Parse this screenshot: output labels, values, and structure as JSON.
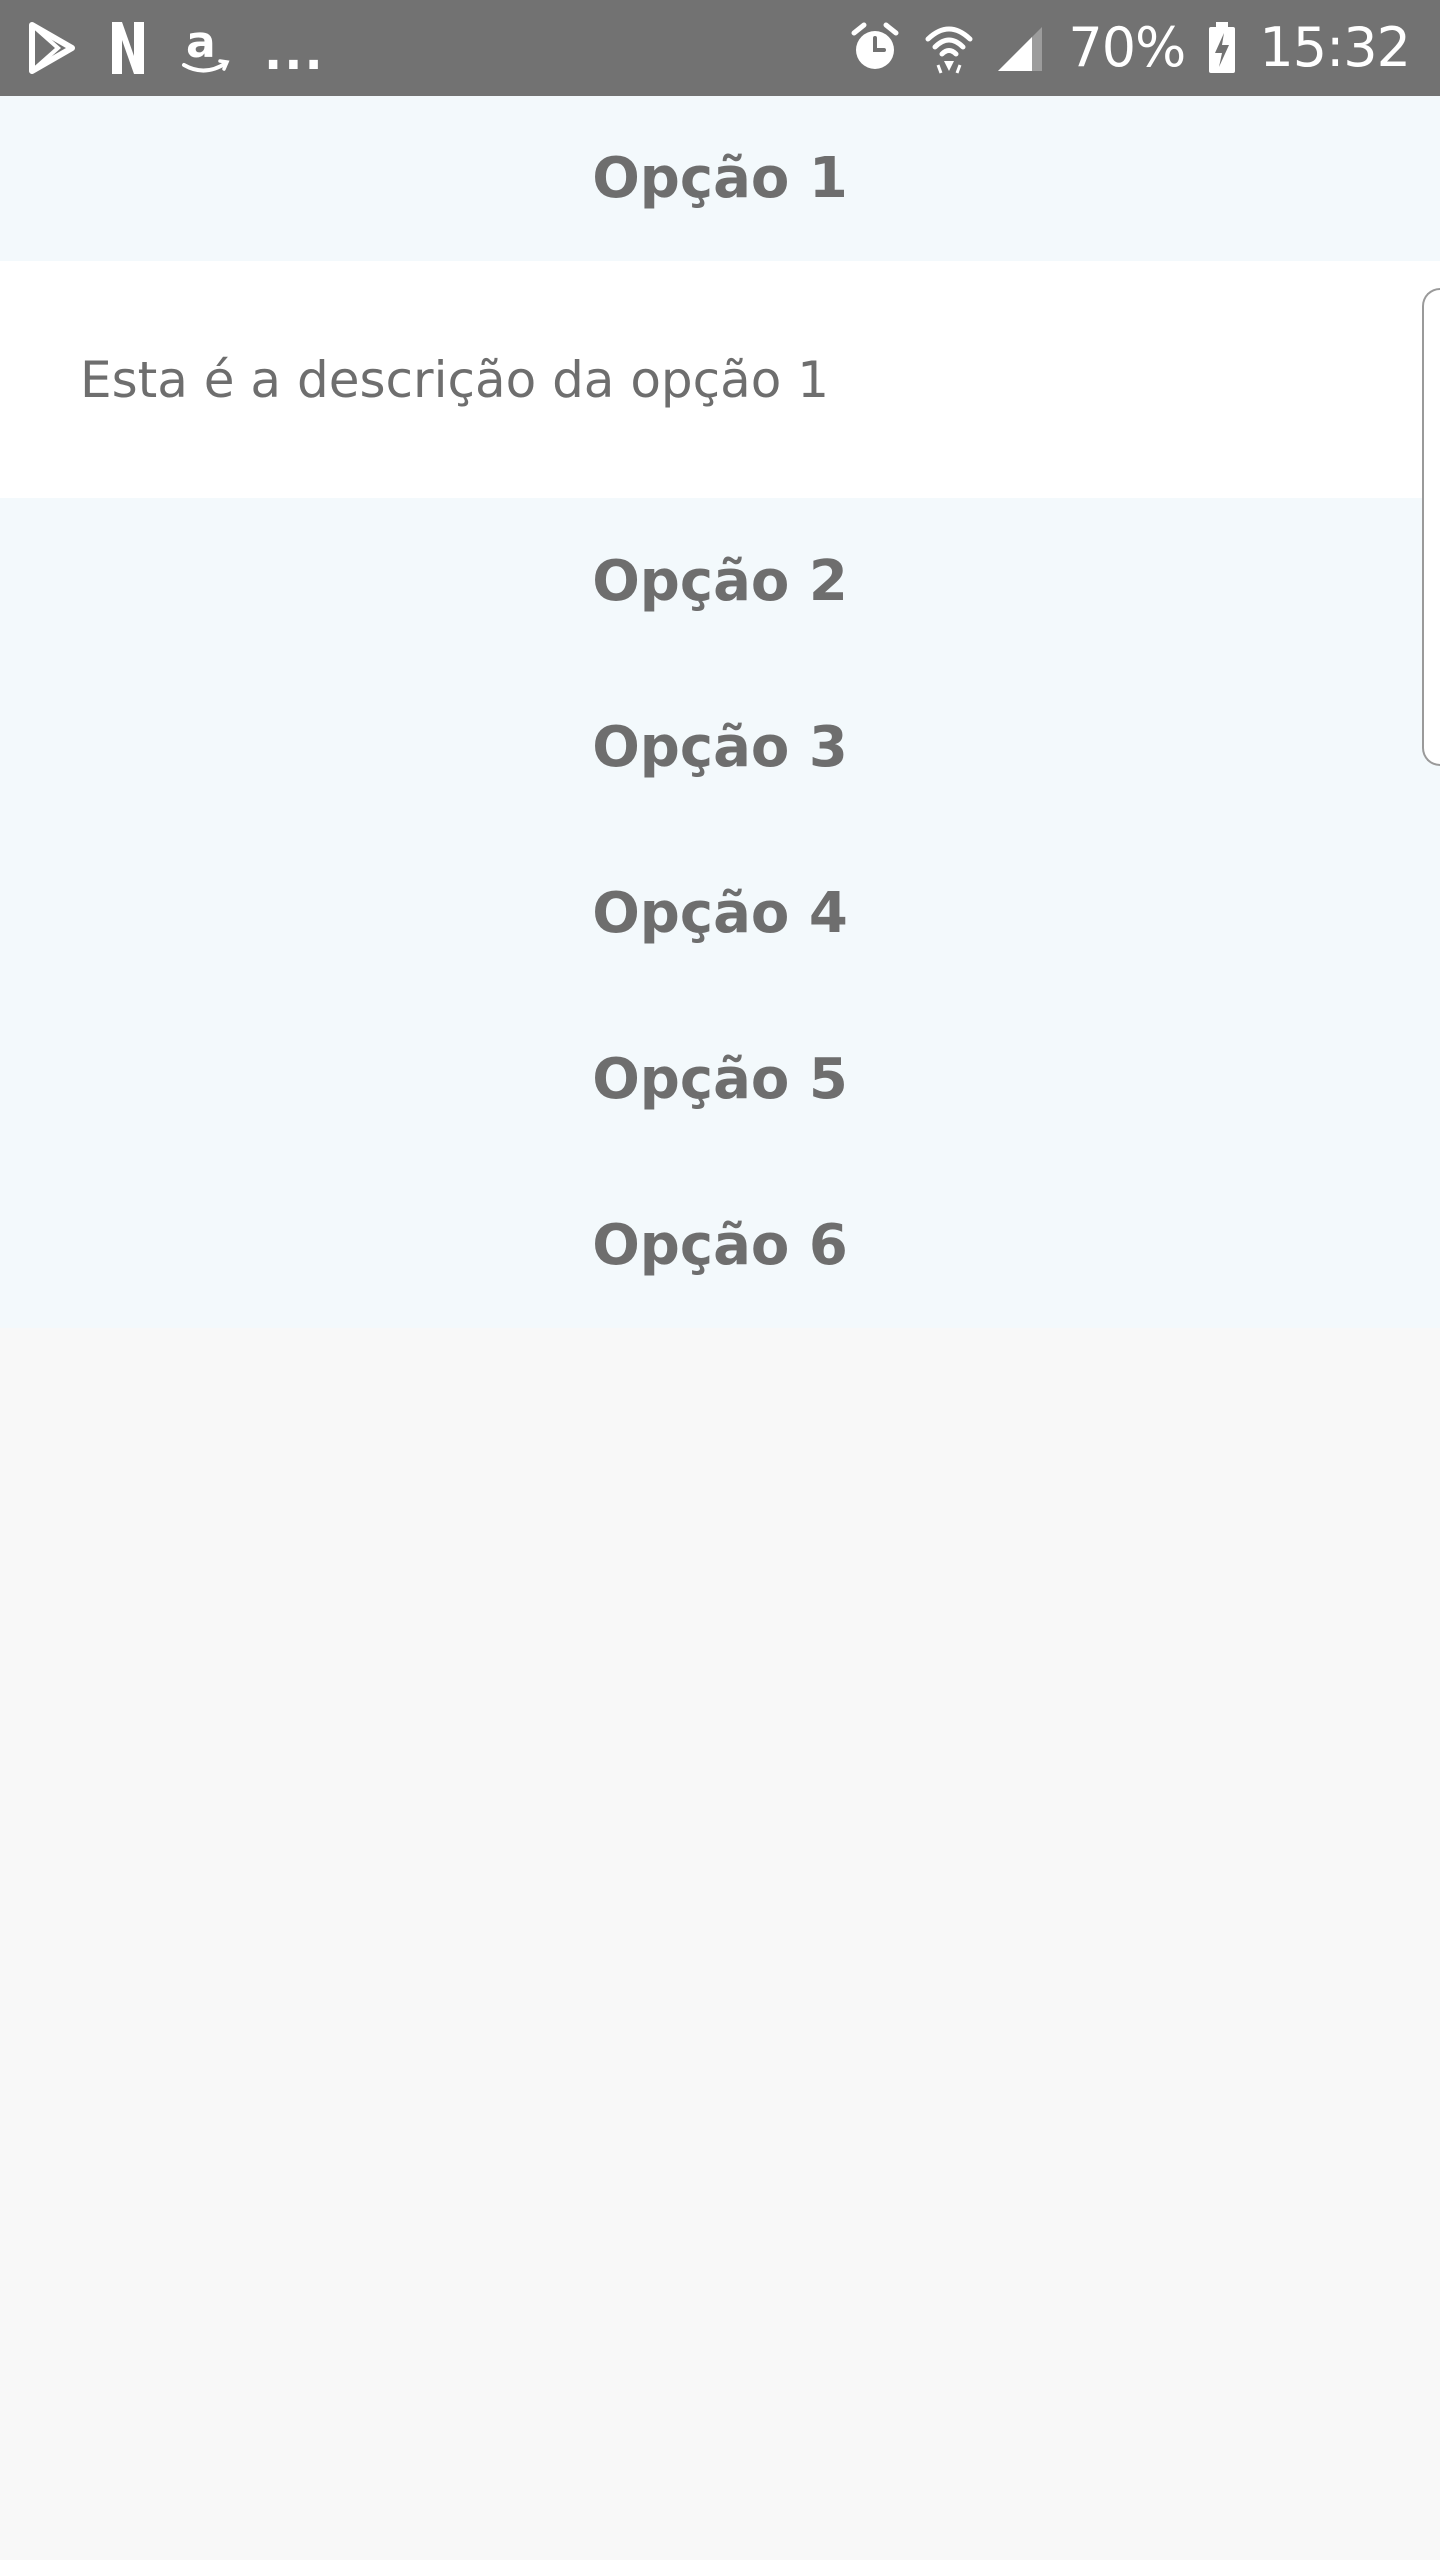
{
  "status_bar": {
    "left_icons": [
      "play-store-icon",
      "n-icon",
      "amazon-icon"
    ],
    "more_indicator": "...",
    "right_icons": [
      "alarm-icon",
      "wifi-icon",
      "signal-icon",
      "battery-charging-icon"
    ],
    "battery_percent": "70%",
    "time": "15:32"
  },
  "accordion": {
    "expanded": {
      "title": "Opção 1",
      "description": "Esta é a descrição da opção 1"
    },
    "items": [
      {
        "title": "Opção 2"
      },
      {
        "title": "Opção 3"
      },
      {
        "title": "Opção 4"
      },
      {
        "title": "Opção 5"
      },
      {
        "title": "Opção 6"
      }
    ]
  },
  "colors": {
    "status_bar_bg": "#727272",
    "header_bg": "#f3f9fc",
    "panel_bg": "#ffffff",
    "page_bg": "#f8f8f8",
    "text": "#6e6e6e"
  }
}
